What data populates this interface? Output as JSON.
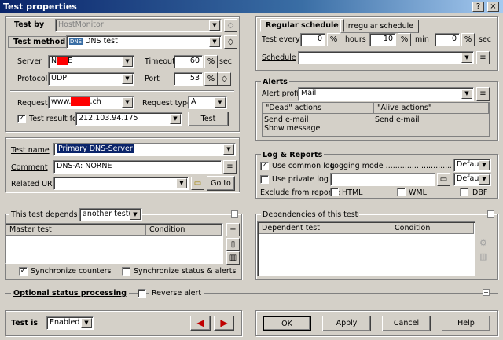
{
  "window": {
    "title": "Test properties",
    "help_btn": "?",
    "close_btn": "×"
  },
  "test_by": {
    "label": "Test by",
    "value": "HostMonitor"
  },
  "test_method": {
    "label": "Test method",
    "badge": "DNS",
    "value": "DNS test"
  },
  "server": {
    "label": "Server",
    "value_prefix": "N",
    "value_suffix": "E"
  },
  "timeout": {
    "label": "Timeout",
    "value": "60",
    "unit": "sec"
  },
  "protocol": {
    "label": "Protocol",
    "value": "UDP"
  },
  "port": {
    "label": "Port",
    "value": "53"
  },
  "request": {
    "label": "Request",
    "value_prefix": "www.",
    "value_suffix": ".ch"
  },
  "request_type": {
    "label": "Request type",
    "value": "A"
  },
  "test_result": {
    "label": "Test result for",
    "checked": true,
    "value": "212.103.94.175",
    "test_btn": "Test"
  },
  "test_name": {
    "label": "Test name",
    "value": "Primary DNS-Server"
  },
  "comment": {
    "label": "Comment",
    "value": "DNS-A: NORNE"
  },
  "related_url": {
    "label": "Related URL",
    "value": "",
    "goto_btn": "Go to"
  },
  "schedule": {
    "tab_regular": "Regular schedule",
    "tab_irregular": "Irregular schedule",
    "test_every": "Test every",
    "days": "0",
    "hours_label": "hours",
    "hours": "10",
    "min_label": "min",
    "min": "0",
    "sec_label": "sec",
    "schedule_label": "Schedule",
    "schedule_value": ""
  },
  "alerts": {
    "title": "Alerts",
    "profile_label": "Alert profile",
    "profile_value": "Mail",
    "col_dead": "\"Dead\" actions",
    "col_alive": "\"Alive actions\"",
    "dead_actions": [
      "Send e-mail",
      "Show message"
    ],
    "alive_actions": [
      "Send e-mail"
    ]
  },
  "log": {
    "title": "Log & Reports",
    "use_common": "Use common log",
    "use_common_checked": true,
    "logging_mode": "Logging mode ..........................................",
    "common_mode": "Default",
    "use_private": "Use private log",
    "use_private_checked": false,
    "private_value": "",
    "private_mode": "Default",
    "exclude_label": "Exclude from reports:",
    "html": "HTML",
    "wml": "WML",
    "dbf": "DBF"
  },
  "depends": {
    "label": "This test depends on",
    "value": "another test(s)",
    "col_master": "Master test",
    "col_condition": "Condition",
    "sync_counters": "Synchronize counters",
    "sync_counters_checked": true,
    "sync_status": "Synchronize status & alerts",
    "sync_status_checked": false
  },
  "dependencies": {
    "title": "Dependencies of this test",
    "col_dependent": "Dependent test",
    "col_condition": "Condition"
  },
  "optional": {
    "label": "Optional status processing",
    "reverse_alert": "Reverse alert",
    "reverse_checked": false
  },
  "test_is": {
    "label": "Test is",
    "value": "Enabled"
  },
  "buttons": {
    "ok": "OK",
    "apply": "Apply",
    "cancel": "Cancel",
    "help": "Help"
  }
}
